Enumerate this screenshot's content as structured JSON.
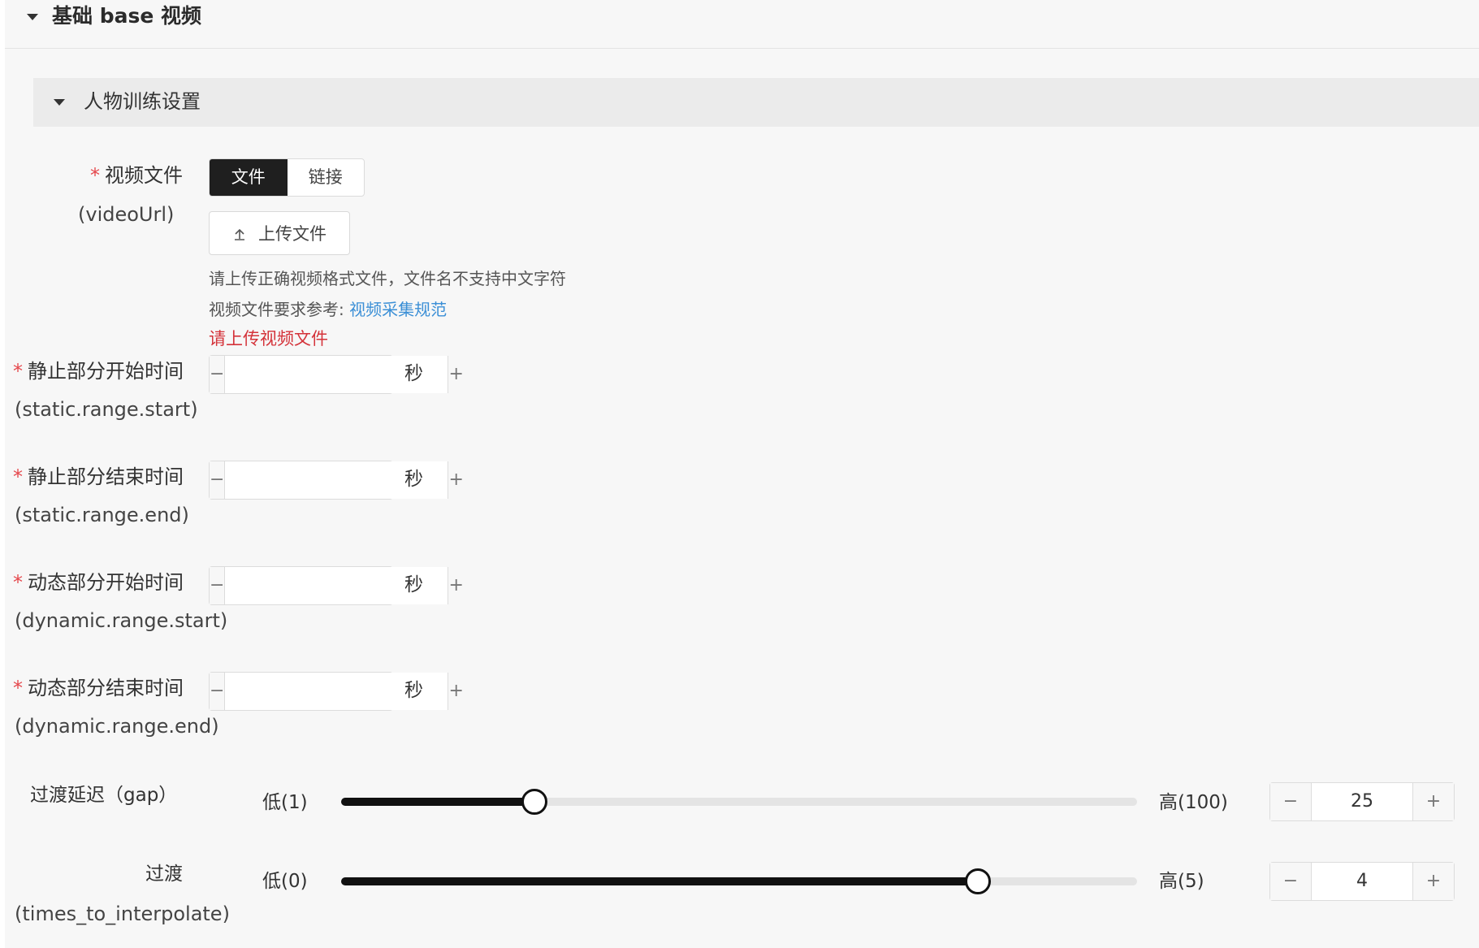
{
  "section": {
    "title": "基础 base 视频"
  },
  "subsection": {
    "title": "人物训练设置"
  },
  "video_file": {
    "required_mark": "*",
    "label": "视频文件",
    "sublabel": "(videoUrl)",
    "segments": [
      {
        "label": "文件",
        "active": true
      },
      {
        "label": "链接",
        "active": false
      }
    ],
    "upload_label": "上传文件",
    "hint_1": "请上传正确视频格式文件，文件名不支持中文字符",
    "hint_2_prefix": "视频文件要求参考: ",
    "hint_2_link": "视频采集规范",
    "error": "请上传视频文件"
  },
  "number_fields": [
    {
      "required_mark": "*",
      "label": "静止部分开始时间",
      "sublabel": "(static.range.start)",
      "value": "",
      "minus": "−",
      "plus": "+",
      "unit": "秒"
    },
    {
      "required_mark": "*",
      "label": "静止部分结束时间",
      "sublabel": "(static.range.end)",
      "value": "",
      "minus": "−",
      "plus": "+",
      "unit": "秒"
    },
    {
      "required_mark": "*",
      "label": "动态部分开始时间",
      "sublabel": "(dynamic.range.start)",
      "value": "",
      "minus": "−",
      "plus": "+",
      "unit": "秒"
    },
    {
      "required_mark": "*",
      "label": "动态部分结束时间",
      "sublabel": "(dynamic.range.end)",
      "value": "",
      "minus": "−",
      "plus": "+",
      "unit": "秒"
    }
  ],
  "sliders": [
    {
      "label": "过渡延迟（gap）",
      "sublabel": "",
      "min_label": "低(1)",
      "max_label": "高(100)",
      "min": 1,
      "max": 100,
      "value": 25,
      "value_text": "25",
      "minus": "−",
      "plus": "+"
    },
    {
      "label": "过渡",
      "sublabel": "(times_to_interpolate)",
      "min_label": "低(0)",
      "max_label": "高(5)",
      "min": 0,
      "max": 5,
      "value": 4,
      "value_text": "4",
      "minus": "−",
      "plus": "+"
    }
  ],
  "icons": {
    "collapse": "caret-down-icon",
    "upload": "upload-icon"
  },
  "colors": {
    "accent_dark": "#1f1f1f",
    "link": "#3b8fd6",
    "error": "#d4333a",
    "required": "#e5484d"
  }
}
